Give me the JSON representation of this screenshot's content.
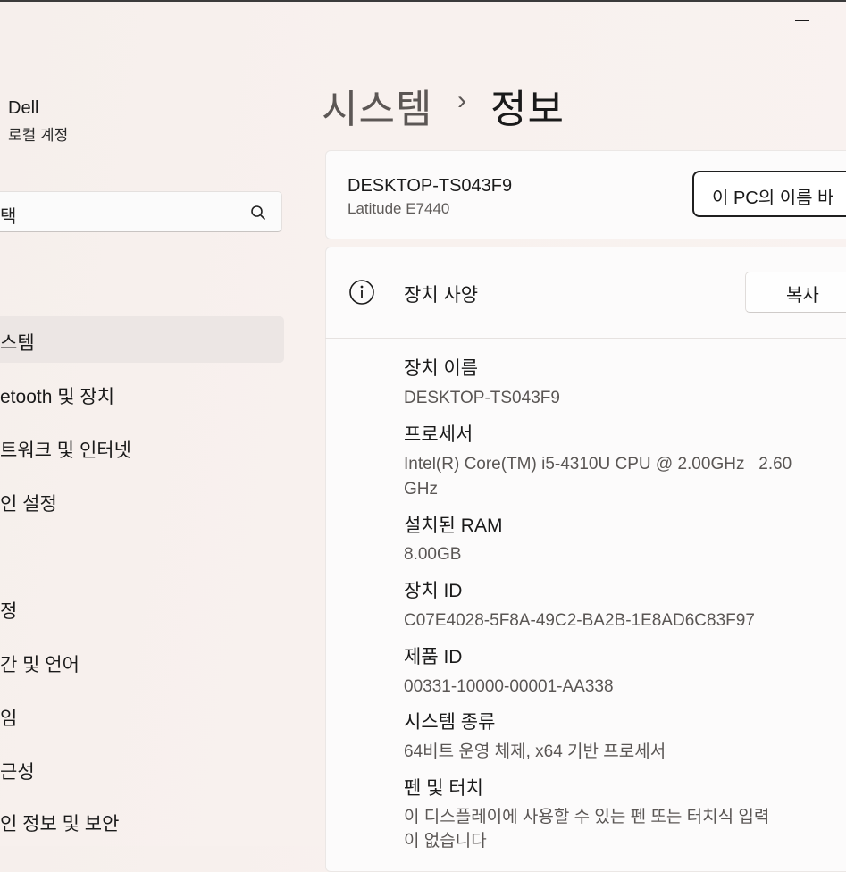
{
  "account": {
    "name": "Dell",
    "type": "로컬 계정"
  },
  "search": {
    "text": "택"
  },
  "sidebar": {
    "items": [
      {
        "label": "스템",
        "selected": true
      },
      {
        "label": "etooth 및 장치",
        "selected": false
      },
      {
        "label": "트워크 및 인터넷",
        "selected": false
      },
      {
        "label": "인 설정",
        "selected": false
      },
      {
        "label": "정",
        "selected": false
      },
      {
        "label": "간 및 언어",
        "selected": false
      },
      {
        "label": "임",
        "selected": false
      },
      {
        "label": "근성",
        "selected": false
      },
      {
        "label": "인 정보 및 보안",
        "selected": false
      }
    ]
  },
  "breadcrumb": {
    "parent": "시스템",
    "separator": "›",
    "current": "정보"
  },
  "device": {
    "name": "DESKTOP-TS043F9",
    "model": "Latitude E7440",
    "rename_button": "이 PC의 이름 바"
  },
  "specs": {
    "title": "장치 사양",
    "copy_button": "복사",
    "items": [
      {
        "label": "장치 이름",
        "value": "DESKTOP-TS043F9"
      },
      {
        "label": "프로세서",
        "value": "Intel(R) Core(TM) i5-4310U CPU @ 2.00GHz   2.60",
        "value2": "GHz"
      },
      {
        "label": "설치된 RAM",
        "value": "8.00GB"
      },
      {
        "label": "장치 ID",
        "value": "C07E4028-5F8A-49C2-BA2B-1E8AD6C83F97"
      },
      {
        "label": "제품 ID",
        "value": "00331-10000-00001-AA338"
      },
      {
        "label": "시스템 종류",
        "value": "64비트 운영 체제, x64 기반 프로세서"
      },
      {
        "label": "펜 및 터치",
        "value": "이 디스플레이에 사용할 수 있는 펜 또는 터치식 입력",
        "value2": "이 없습니다"
      }
    ]
  }
}
